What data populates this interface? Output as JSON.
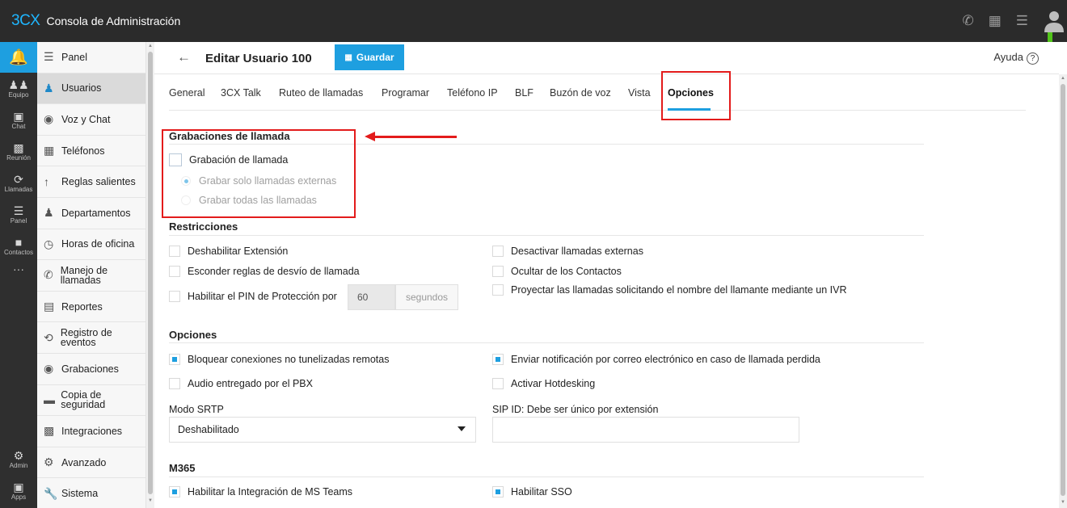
{
  "app": {
    "logo": "3CX",
    "title": "Consola de Administración"
  },
  "rail": {
    "items": [
      {
        "icon": "team-icon",
        "label": "Equipo"
      },
      {
        "icon": "chat-icon",
        "label": "Chat"
      },
      {
        "icon": "meeting-icon",
        "label": "Reunión"
      },
      {
        "icon": "calls-icon",
        "label": "Llamadas"
      },
      {
        "icon": "panel-icon",
        "label": "Panel"
      },
      {
        "icon": "contacts-icon",
        "label": "Contactos"
      }
    ],
    "more": "···",
    "bottom": [
      {
        "icon": "admin-gear-icon",
        "label": "Admin"
      },
      {
        "icon": "apps-icon",
        "label": "Apps"
      }
    ]
  },
  "nav": {
    "items": [
      {
        "icon": "panel-icon",
        "label": "Panel"
      },
      {
        "icon": "users-icon",
        "label": "Usuarios",
        "active": true
      },
      {
        "icon": "voice-chat-icon",
        "label": "Voz y Chat"
      },
      {
        "icon": "phones-icon",
        "label": "Teléfonos"
      },
      {
        "icon": "outbound-rules-icon",
        "label": "Reglas salientes"
      },
      {
        "icon": "departments-icon",
        "label": "Departamentos"
      },
      {
        "icon": "office-hours-icon",
        "label": "Horas de oficina"
      },
      {
        "icon": "call-handling-icon",
        "label": "Manejo de llamadas"
      },
      {
        "icon": "reports-icon",
        "label": "Reportes"
      },
      {
        "icon": "event-log-icon",
        "label": "Registro de eventos"
      },
      {
        "icon": "recordings-icon",
        "label": "Grabaciones"
      },
      {
        "icon": "backup-icon",
        "label": "Copia de seguridad"
      },
      {
        "icon": "integrations-icon",
        "label": "Integraciones"
      },
      {
        "icon": "advanced-icon",
        "label": "Avanzado"
      },
      {
        "icon": "system-icon",
        "label": "Sistema"
      }
    ]
  },
  "header": {
    "back_icon": "back-arrow-icon",
    "title": "Editar Usuario 100",
    "save_label": "Guardar",
    "help_label": "Ayuda",
    "help_icon": "?"
  },
  "tabs": [
    "General",
    "3CX Talk",
    "Ruteo de llamadas",
    "Programar",
    "Teléfono IP",
    "BLF",
    "Buzón de voz",
    "Vista",
    "Opciones"
  ],
  "active_tab": "Opciones",
  "recordings": {
    "title": "Grabaciones de llamada",
    "enable_label": "Grabación de llamada",
    "enable_checked": false,
    "radio_external": "Grabar solo llamadas externas",
    "radio_all": "Grabar todas las llamadas",
    "selected": "Grabar solo llamadas externas"
  },
  "restrictions": {
    "title": "Restricciones",
    "disable_extension": "Deshabilitar Extensión",
    "hide_forwarding": "Esconder reglas de desvío de llamada",
    "pin_label": "Habilitar el PIN de Protección por",
    "pin_value": "60",
    "pin_suffix": "segundos",
    "disable_external": "Desactivar llamadas externas",
    "hide_contacts": "Ocultar de los Contactos",
    "screen_calls": "Proyectar las llamadas solicitando el nombre del llamante mediante un IVR"
  },
  "options": {
    "title": "Opciones",
    "block_remote": "Bloquear conexiones no tunelizadas remotas",
    "block_remote_checked": true,
    "audio_pbx": "Audio entregado por el PBX",
    "audio_pbx_checked": false,
    "email_missed": "Enviar notificación por correo electrónico en caso de llamada perdida",
    "email_missed_checked": true,
    "hotdesking": "Activar Hotdesking",
    "hotdesking_checked": false,
    "srtp_label": "Modo SRTP",
    "srtp_value": "Deshabilitado",
    "sipid_label": "SIP ID: Debe ser único por extensión",
    "sipid_value": ""
  },
  "m365": {
    "title": "M365",
    "teams": "Habilitar la Integración de MS Teams",
    "teams_checked": true,
    "sso": "Habilitar SSO",
    "sso_checked": true
  },
  "colors": {
    "accent": "#1e9fe0",
    "annotation": "#e31b1b",
    "topbar": "#2b2b2b",
    "rail": "#2f2f2f"
  }
}
